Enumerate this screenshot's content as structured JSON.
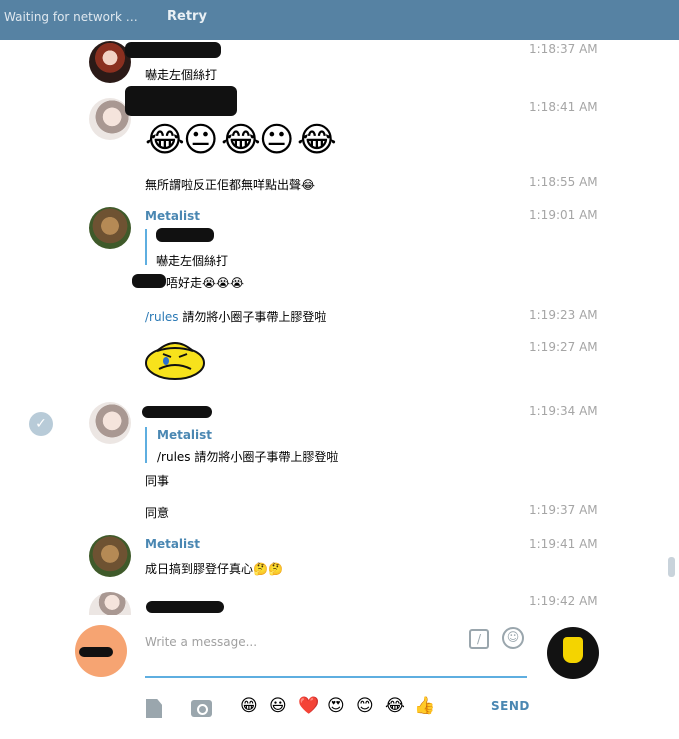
{
  "topbar": {
    "status": "Waiting for network …",
    "retry": "Retry"
  },
  "messages": {
    "m1": {
      "time": "1:18:37 AM",
      "text": "嚇走左個絲打"
    },
    "m2": {
      "time": "1:18:41 AM",
      "emojis": [
        "😂",
        "😐",
        "😂",
        "😐",
        "😂"
      ]
    },
    "m3": {
      "time": "1:18:55 AM",
      "text": "無所謂啦反正佢都無咩點出聲😂"
    },
    "m4": {
      "sender": "Metalist",
      "time": "1:19:01 AM",
      "quote_text": "嚇走左個絲打",
      "text": "唔好走😭😭😭"
    },
    "m5": {
      "time": "1:19:23 AM",
      "command": "/rules",
      "text": " 請勿將小圈子事帶上膠登啦"
    },
    "m6": {
      "time": "1:19:27 AM",
      "sticker": "crying-duck-sticker"
    },
    "m7": {
      "time": "1:19:34 AM",
      "quote_sender": "Metalist",
      "quote_text": "/rules 請勿將小圈子事帶上膠登啦",
      "text": "同事"
    },
    "m8": {
      "time": "1:19:37 AM",
      "text": "同意"
    },
    "m9": {
      "sender": "Metalist",
      "time": "1:19:41 AM",
      "text": "成日搞到膠登仔真心🤔🤔"
    },
    "m10": {
      "time": "1:19:42 AM"
    }
  },
  "composer": {
    "placeholder": "Write a message...",
    "send_label": "SEND",
    "quick_emojis": [
      "😁",
      "😃",
      "❤️",
      "😍",
      "😊",
      "😂",
      "👍"
    ]
  },
  "colors": {
    "header": "#5682a3",
    "accent": "#4a87b2",
    "input_line": "#5eaee0"
  }
}
